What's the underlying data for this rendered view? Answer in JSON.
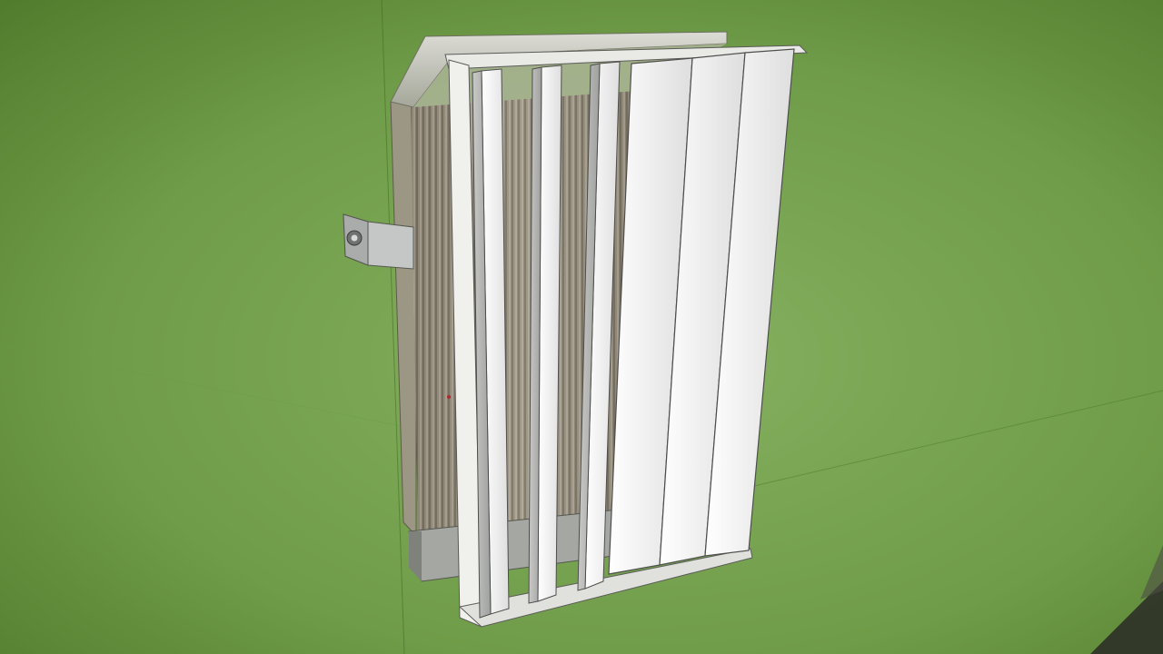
{
  "scene": {
    "subject": "louvered-radiator-model",
    "background_colors": {
      "top_left": "#4f7d2c",
      "center": "#78a553",
      "bottom": "#6f9e4c"
    },
    "louver_count": 6,
    "louver_color": "#e8e8e6",
    "core_color": "#8f8a7c",
    "frame_color": "#d9d9d6",
    "bracket_color": "#b9bcbc"
  }
}
